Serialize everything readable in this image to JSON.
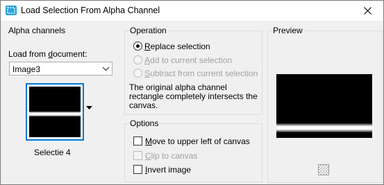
{
  "window": {
    "title": "Load Selection From Alpha Channel"
  },
  "alpha": {
    "group_title": "Alpha channels",
    "load_label_pre": "Load from ",
    "load_label_u": "d",
    "load_label_post": "ocument:",
    "document_value": "Image3",
    "thumbnail_label": "Selectie 4"
  },
  "operation": {
    "group_title": "Operation",
    "replace": {
      "u": "R",
      "rest": "eplace selection",
      "selected": true,
      "enabled": true
    },
    "add": {
      "u": "A",
      "rest": "dd to current selection",
      "selected": false,
      "enabled": false
    },
    "subtract": {
      "u": "S",
      "rest": "ubtract from current selection",
      "selected": false,
      "enabled": false
    },
    "message": "The original alpha channel rectangle completely intersects the canvas."
  },
  "options": {
    "group_title": "Options",
    "move": {
      "u": "M",
      "rest": "ove to upper left of canvas",
      "checked": false,
      "enabled": true
    },
    "clip": {
      "u": "C",
      "rest": "lip to canvas",
      "checked": false,
      "enabled": false
    },
    "invert": {
      "u": "I",
      "rest": "nvert image",
      "checked": false,
      "enabled": true
    }
  },
  "preview": {
    "group_title": "Preview"
  },
  "icons": {
    "app": "selection-app-icon",
    "close": "close-icon",
    "dropdown": "chevron-down-icon",
    "checker": "transparency-checker-icon"
  }
}
